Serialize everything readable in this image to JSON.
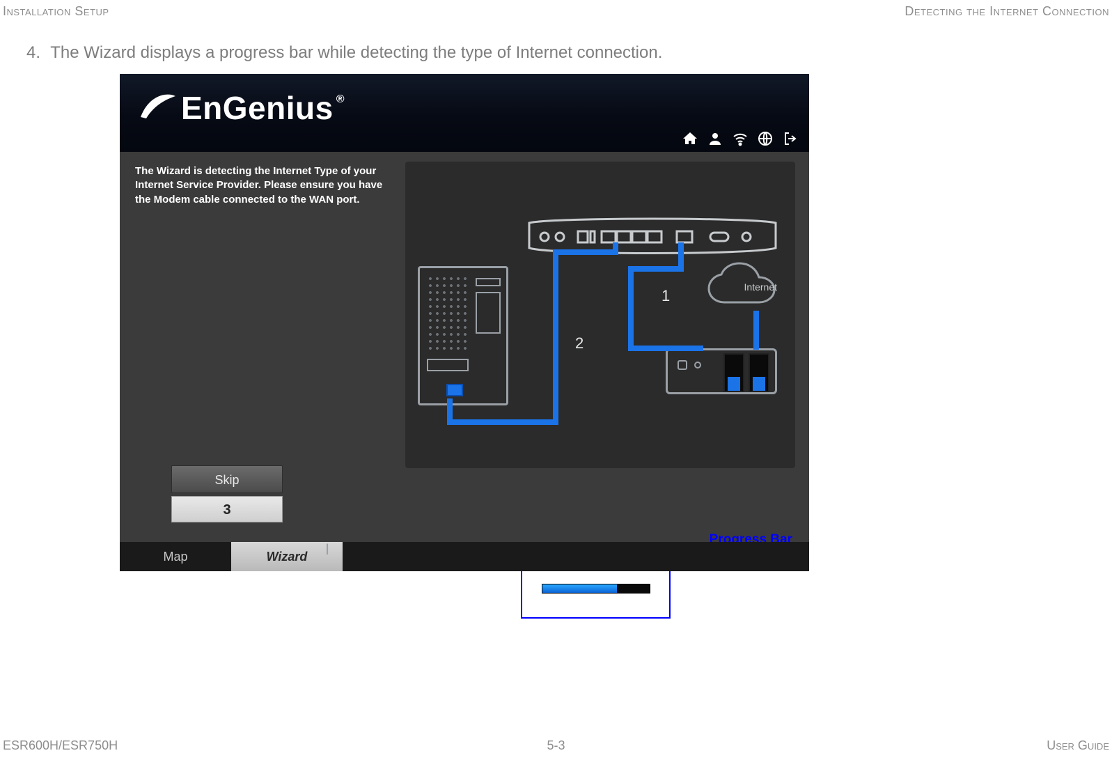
{
  "header": {
    "left": "Installation Setup",
    "right": "Detecting the Internet Connection"
  },
  "footer": {
    "left": "ESR600H/ESR750H",
    "center": "5-3",
    "right": "User Guide"
  },
  "step": {
    "number": "4.",
    "text": "The Wizard displays a progress bar while detecting the type of Internet connection."
  },
  "brand": {
    "name": "EnGenius",
    "mark": "®"
  },
  "wizard_msg": "The Wizard is detecting the Internet Type of your Internet Service Provider. Please ensure you have the Modem cable connected to the WAN port.",
  "diagram": {
    "cloud_label": "Internet",
    "num1": "1",
    "num2": "2"
  },
  "buttons": {
    "skip": "Skip",
    "step_badge": "3"
  },
  "tabs": {
    "map": "Map",
    "wizard": "Wizard"
  },
  "annotation": {
    "label": "Progress Bar"
  },
  "progress": {
    "percent": 70
  }
}
